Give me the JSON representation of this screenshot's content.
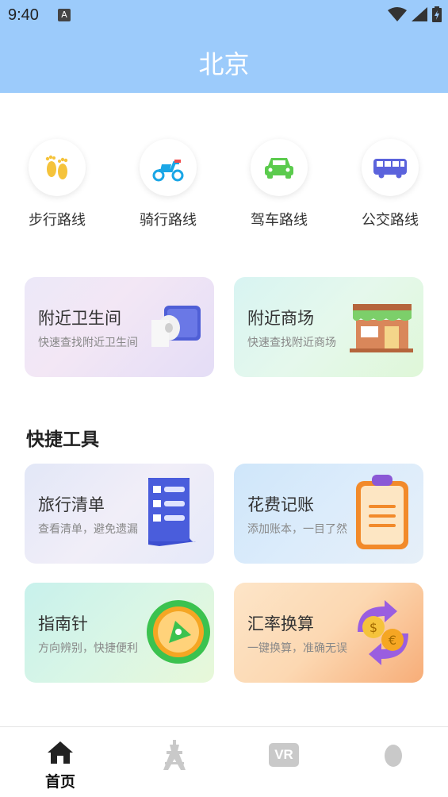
{
  "status_bar": {
    "time": "9:40",
    "notification_badge": "A"
  },
  "header": {
    "title": "北京",
    "background": "#9ccbfb"
  },
  "routes": [
    {
      "label": "步行路线",
      "icon": "footprints-icon",
      "color": "#f5c33b"
    },
    {
      "label": "骑行路线",
      "icon": "scooter-icon",
      "color": "#1aa6e6"
    },
    {
      "label": "驾车路线",
      "icon": "car-icon",
      "color": "#5bcb4d"
    },
    {
      "label": "公交路线",
      "icon": "bus-icon",
      "color": "#5b63dc"
    }
  ],
  "nearby": [
    {
      "title": "附近卫生间",
      "subtitle": "快速查找附近卫生间",
      "icon": "toilet-paper-icon"
    },
    {
      "title": "附近商场",
      "subtitle": "快速查找附近商场",
      "icon": "store-icon"
    }
  ],
  "tools_section": {
    "title": "快捷工具"
  },
  "tools": [
    {
      "title": "旅行清单",
      "subtitle": "查看清单，避免遗漏",
      "icon": "checklist-icon"
    },
    {
      "title": "花费记账",
      "subtitle": "添加账本，一目了然",
      "icon": "clipboard-icon"
    },
    {
      "title": "指南针",
      "subtitle": "方向辨别，快捷便利",
      "icon": "compass-icon"
    },
    {
      "title": "汇率换算",
      "subtitle": "一键换算，准确无误",
      "icon": "currency-exchange-icon"
    }
  ],
  "tabbar": {
    "items": [
      {
        "label": "首页",
        "icon": "home-icon",
        "active": true
      },
      {
        "label": "",
        "icon": "tower-icon",
        "active": false
      },
      {
        "label": "",
        "icon": "vr-icon",
        "badge": "VR",
        "active": false
      },
      {
        "label": "",
        "icon": "profile-icon",
        "active": false
      }
    ]
  }
}
